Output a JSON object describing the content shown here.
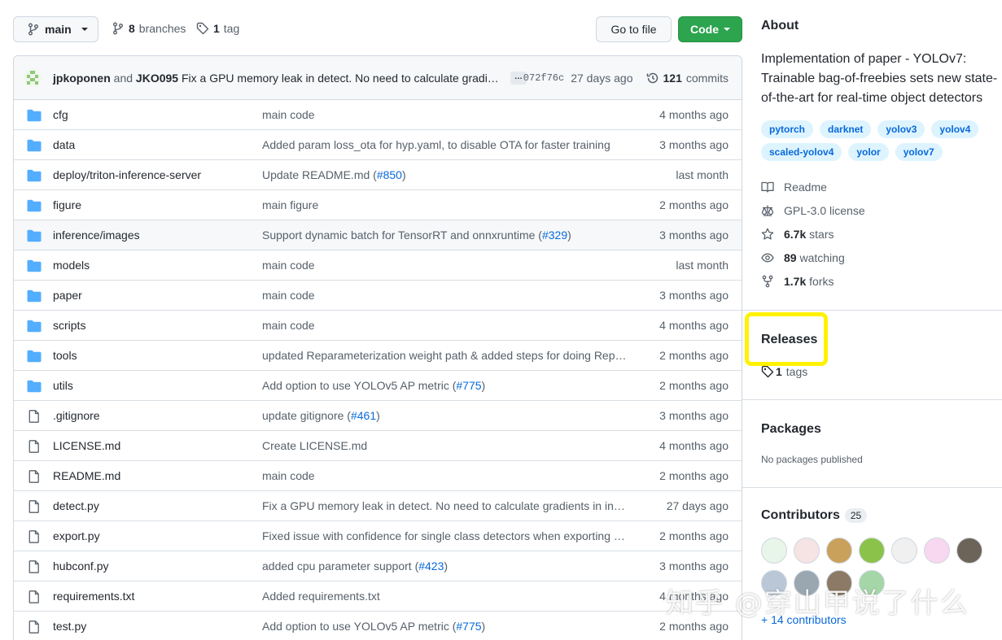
{
  "toolbar": {
    "branch": "main",
    "branches_count": "8",
    "branches_label": "branches",
    "tags_count": "1",
    "tags_label": "tag",
    "goto_file": "Go to file",
    "code": "Code"
  },
  "latest_commit": {
    "author1": "jpkoponen",
    "and": "and",
    "author2": "JKO095",
    "message": "Fix a GPU memory leak in detect. No need to calculate gradi…",
    "ellipsis": "…",
    "sha": "072f76c",
    "age": "27 days ago",
    "commits_count": "121",
    "commits_label": "commits"
  },
  "files": [
    {
      "type": "dir",
      "name": "cfg",
      "msg": "main code",
      "pr": "",
      "msg_end": "",
      "age": "4 months ago"
    },
    {
      "type": "dir",
      "name": "data",
      "msg": "Added param loss_ota for hyp.yaml, to disable OTA for faster training",
      "pr": "",
      "msg_end": "",
      "age": "3 months ago"
    },
    {
      "type": "dir",
      "name": "deploy/triton-inference-server",
      "msg": "Update README.md (",
      "pr": "#850",
      "msg_end": ")",
      "age": "last month"
    },
    {
      "type": "dir",
      "name": "figure",
      "msg": "main figure",
      "pr": "",
      "msg_end": "",
      "age": "2 months ago"
    },
    {
      "type": "dir",
      "name": "inference/images",
      "msg": "Support dynamic batch for TensorRT and onnxruntime (",
      "pr": "#329",
      "msg_end": ")",
      "age": "3 months ago"
    },
    {
      "type": "dir",
      "name": "models",
      "msg": "main code",
      "pr": "",
      "msg_end": "",
      "age": "last month"
    },
    {
      "type": "dir",
      "name": "paper",
      "msg": "main code",
      "pr": "",
      "msg_end": "",
      "age": "3 months ago"
    },
    {
      "type": "dir",
      "name": "scripts",
      "msg": "main code",
      "pr": "",
      "msg_end": "",
      "age": "4 months ago"
    },
    {
      "type": "dir",
      "name": "tools",
      "msg": "updated Reparameterization weight path & added steps for doing Repa…",
      "pr": "",
      "msg_end": "",
      "age": "2 months ago"
    },
    {
      "type": "dir",
      "name": "utils",
      "msg": "Add option to use YOLOv5 AP metric (",
      "pr": "#775",
      "msg_end": ")",
      "age": "2 months ago"
    },
    {
      "type": "file",
      "name": ".gitignore",
      "msg": "update gitignore (",
      "pr": "#461",
      "msg_end": ")",
      "age": "3 months ago"
    },
    {
      "type": "file",
      "name": "LICENSE.md",
      "msg": "Create LICENSE.md",
      "pr": "",
      "msg_end": "",
      "age": "4 months ago"
    },
    {
      "type": "file",
      "name": "README.md",
      "msg": "main code",
      "pr": "",
      "msg_end": "",
      "age": "2 months ago"
    },
    {
      "type": "file",
      "name": "detect.py",
      "msg": "Fix a GPU memory leak in detect. No need to calculate gradients in in…",
      "pr": "",
      "msg_end": "",
      "age": "27 days ago"
    },
    {
      "type": "file",
      "name": "export.py",
      "msg": "Fixed issue with confidence for single class detectors when exporting (",
      "pr": "…",
      "msg_end": "",
      "age": "2 months ago"
    },
    {
      "type": "file",
      "name": "hubconf.py",
      "msg": "added cpu parameter support (",
      "pr": "#423",
      "msg_end": ")",
      "age": "3 months ago"
    },
    {
      "type": "file",
      "name": "requirements.txt",
      "msg": "Added requirements.txt",
      "pr": "",
      "msg_end": "",
      "age": "4 months ago"
    },
    {
      "type": "file",
      "name": "test.py",
      "msg": "Add option to use YOLOv5 AP metric (",
      "pr": "#775",
      "msg_end": ")",
      "age": "2 months ago"
    }
  ],
  "about": {
    "heading": "About",
    "description": "Implementation of paper - YOLOv7: Trainable bag-of-freebies sets new state-of-the-art for real-time object detectors",
    "topics": [
      "pytorch",
      "darknet",
      "yolov3",
      "yolov4",
      "scaled-yolov4",
      "yolor",
      "yolov7"
    ],
    "readme": "Readme",
    "license": "GPL-3.0 license",
    "stars_count": "6.7k",
    "stars_label": "stars",
    "watching_count": "89",
    "watching_label": "watching",
    "forks_count": "1.7k",
    "forks_label": "forks"
  },
  "releases": {
    "heading": "Releases",
    "tags_count": "1",
    "tags_label": "tags"
  },
  "packages": {
    "heading": "Packages",
    "empty": "No packages published"
  },
  "contributors": {
    "heading": "Contributors",
    "count": "25",
    "more": "+ 14 contributors",
    "avatar_colors": [
      "#e8f5e9",
      "#f6e3e3",
      "#c9a15a",
      "#8bc34a",
      "#f0f0f0",
      "#f8d7f0",
      "#6d6459",
      "#b9c7d6",
      "#9aa7b0",
      "#8d7a66",
      "#a5d6a7"
    ]
  },
  "watermark": "知乎 @穿山甲说了什么",
  "colors": {
    "accent": "#0969da",
    "code_green": "#2da44e",
    "folder_blue": "#54aeff",
    "highlight": "#fff200"
  }
}
